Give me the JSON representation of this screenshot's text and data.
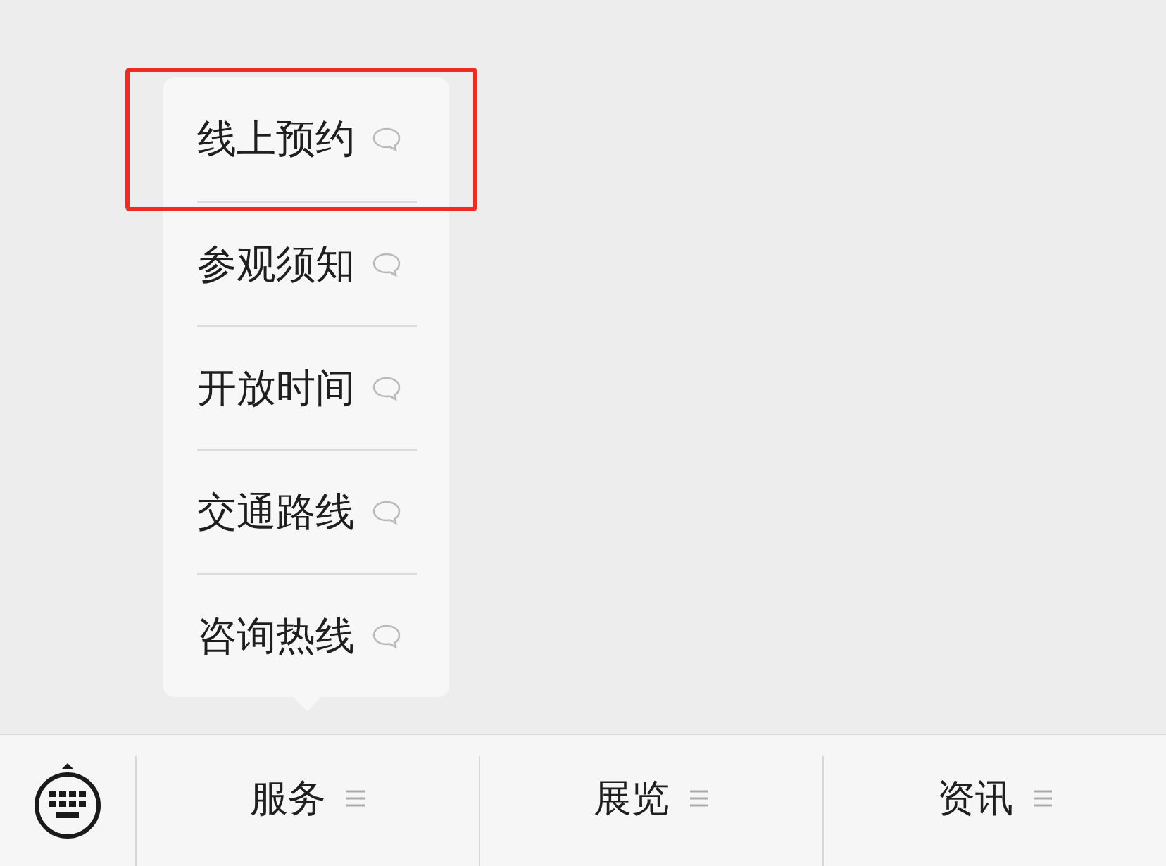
{
  "submenu": {
    "items": [
      {
        "label": "线上预约",
        "highlighted": true
      },
      {
        "label": "参观须知",
        "highlighted": false
      },
      {
        "label": "开放时间",
        "highlighted": false
      },
      {
        "label": "交通路线",
        "highlighted": false
      },
      {
        "label": "咨询热线",
        "highlighted": false
      }
    ]
  },
  "menu_bar": {
    "items": [
      {
        "label": "服务"
      },
      {
        "label": "展览"
      },
      {
        "label": "资讯"
      }
    ]
  }
}
